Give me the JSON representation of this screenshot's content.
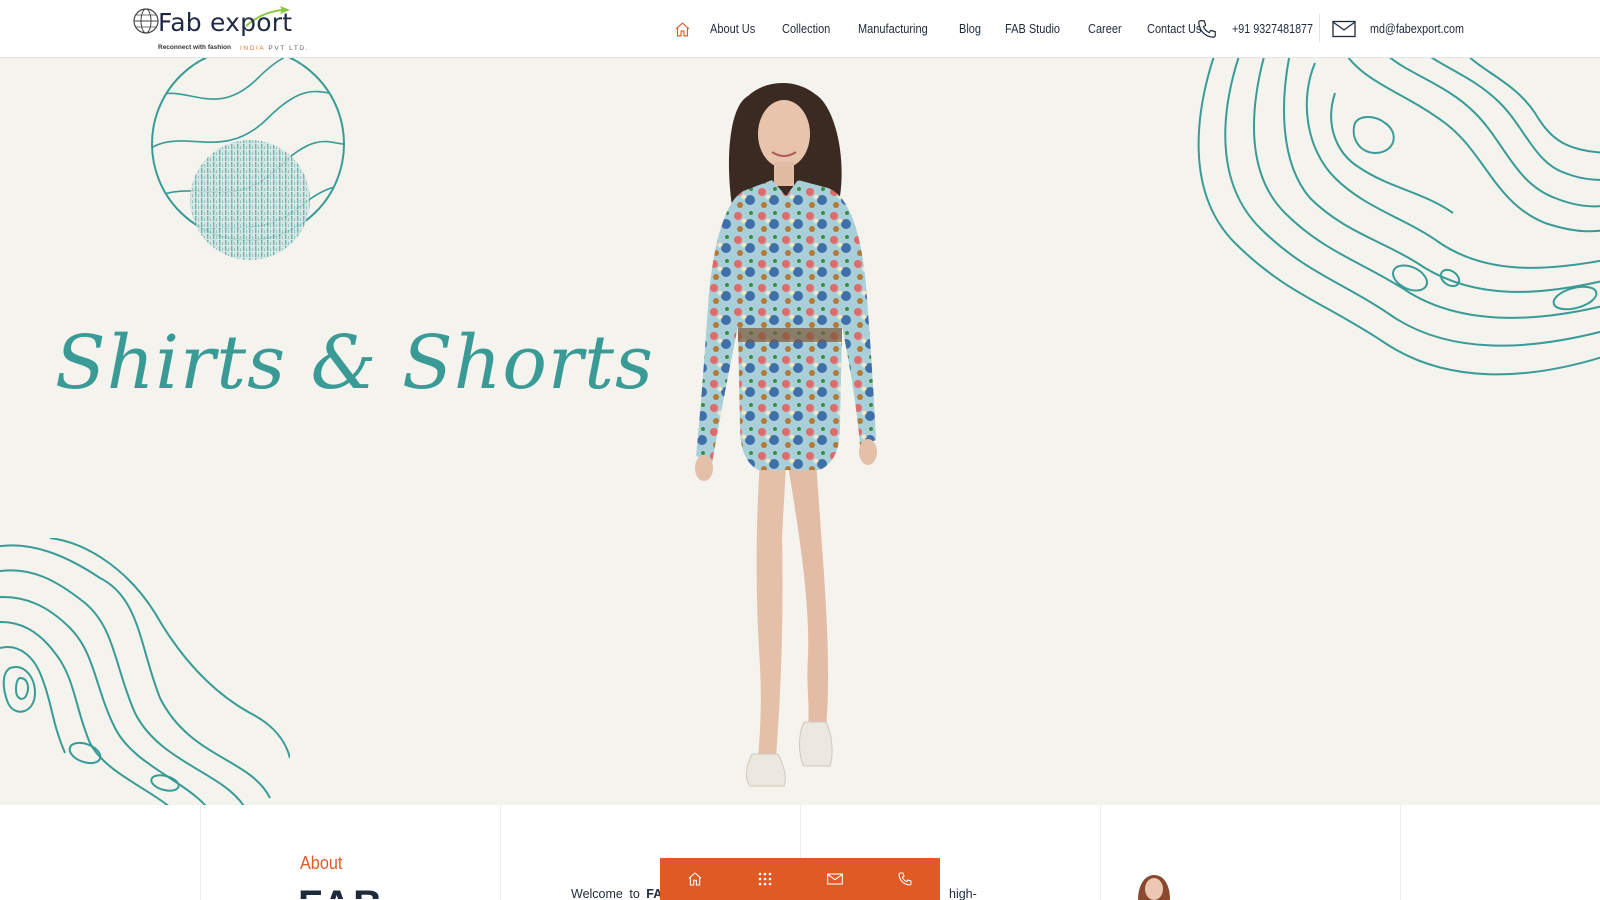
{
  "header": {
    "logo": {
      "brand": "Fab export",
      "tagline": "Reconnect with fashion",
      "sub_highlight": "INDIA",
      "sub_rest": " PVT LTD."
    },
    "nav": {
      "home_icon": "home-icon",
      "items": [
        {
          "label": "About Us"
        },
        {
          "label": "Collection"
        },
        {
          "label": "Manufacturing"
        },
        {
          "label": "Blog"
        },
        {
          "label": "FAB Studio"
        },
        {
          "label": "Career"
        },
        {
          "label": "Contact Us"
        }
      ]
    },
    "contact": {
      "phone": "+91 9327481877",
      "phone_icon": "phone-icon",
      "email": "md@fabexport.com",
      "email_icon": "mail-icon"
    }
  },
  "hero": {
    "title": "Shirts & Shorts"
  },
  "about": {
    "label": "About",
    "heading": "FAB",
    "welcome_prefix": "Welcome to",
    "welcome_bold": "FAB",
    "trailing_text": "high-"
  },
  "bottom_bar": {
    "icons": [
      "home-icon",
      "grid-icon",
      "mail-icon",
      "phone-icon"
    ]
  },
  "colors": {
    "accent": "#e05a26",
    "teal": "#3a9b96",
    "hero_bg": "#f4f3ee",
    "text": "#1e2a3a"
  }
}
